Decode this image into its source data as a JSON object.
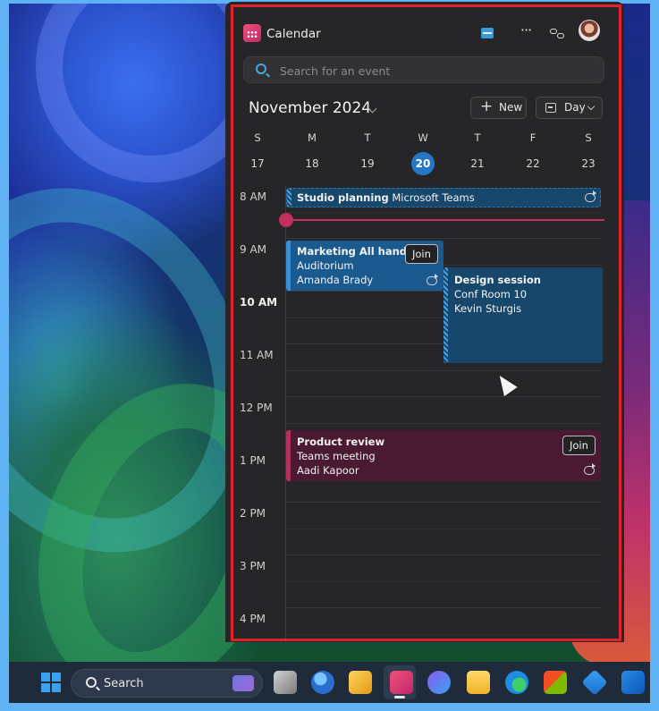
{
  "calendar": {
    "app_title": "Calendar",
    "search_placeholder": "Search for an event",
    "month_label": "November 2024",
    "new_button_label": "New",
    "view_button_label": "Day",
    "weekdays": [
      "S",
      "M",
      "T",
      "W",
      "T",
      "F",
      "S"
    ],
    "dates": [
      "17",
      "18",
      "19",
      "20",
      "21",
      "22",
      "23"
    ],
    "today": "20",
    "time_labels": [
      "8 AM",
      "9 AM",
      "10 AM",
      "11 AM",
      "12 PM",
      "1 PM",
      "2 PM",
      "3 PM",
      "4 PM"
    ],
    "events": {
      "studio": {
        "title": "Studio planning",
        "location": "Microsoft Teams",
        "recurring": true
      },
      "marketing": {
        "title": "Marketing All hands",
        "location": "Auditorium",
        "organizer": "Amanda Brady",
        "join_label": "Join",
        "recurring": true
      },
      "design": {
        "title": "Design session",
        "location": "Conf Room 10",
        "organizer": "Kevin Sturgis"
      },
      "product": {
        "title": "Product review",
        "location": "Teams meeting",
        "organizer": "Aadi Kapoor",
        "join_label": "Join",
        "recurring": true
      }
    }
  },
  "taskbar": {
    "search_label": "Search",
    "apps": [
      "task-view",
      "people",
      "notes",
      "calendar",
      "copilot",
      "file-explorer",
      "edge",
      "store",
      "copilot-app",
      "outlook"
    ]
  },
  "colors": {
    "accent": "#2577c6",
    "current_time": "#c4305e",
    "highlight_frame": "#e0202a"
  }
}
